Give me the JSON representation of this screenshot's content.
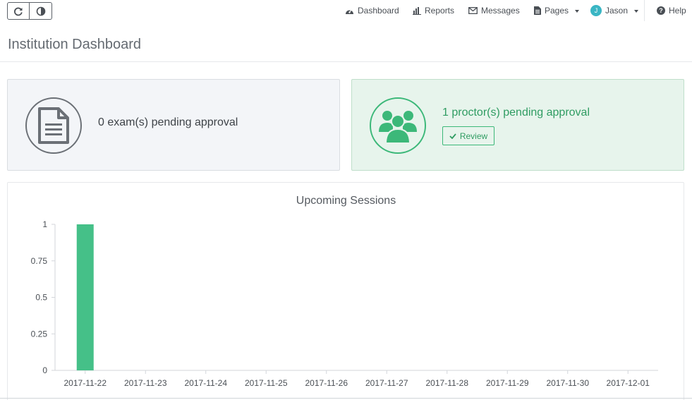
{
  "toolbar": {
    "refresh_icon": "refresh-icon",
    "contrast_icon": "contrast-icon"
  },
  "nav": {
    "dashboard": "Dashboard",
    "reports": "Reports",
    "messages": "Messages",
    "pages": "Pages",
    "user_initial": "J",
    "user_name": "Jason",
    "help": "Help"
  },
  "page": {
    "title": "Institution Dashboard"
  },
  "cards": {
    "exams": {
      "text": "0 exam(s) pending approval",
      "icon": "document-icon"
    },
    "proctors": {
      "text": "1 proctor(s) pending approval",
      "icon": "users-icon",
      "review_label": "Review"
    }
  },
  "colors": {
    "accent_green": "#3cb879",
    "bar_green": "#45c088",
    "proctor_bg": "#e7f4ec",
    "exam_bg": "#f3f5f8"
  },
  "chart_data": {
    "type": "bar",
    "title": "Upcoming Sessions",
    "categories": [
      "2017-11-22",
      "2017-11-23",
      "2017-11-24",
      "2017-11-25",
      "2017-11-26",
      "2017-11-27",
      "2017-11-28",
      "2017-11-29",
      "2017-11-30",
      "2017-12-01"
    ],
    "values": [
      1,
      0,
      0,
      0,
      0,
      0,
      0,
      0,
      0,
      0
    ],
    "yticks": [
      "0",
      "0.25",
      "0.5",
      "0.75",
      "1"
    ],
    "ylim": [
      0,
      1
    ],
    "grid": false,
    "legend": "none"
  }
}
